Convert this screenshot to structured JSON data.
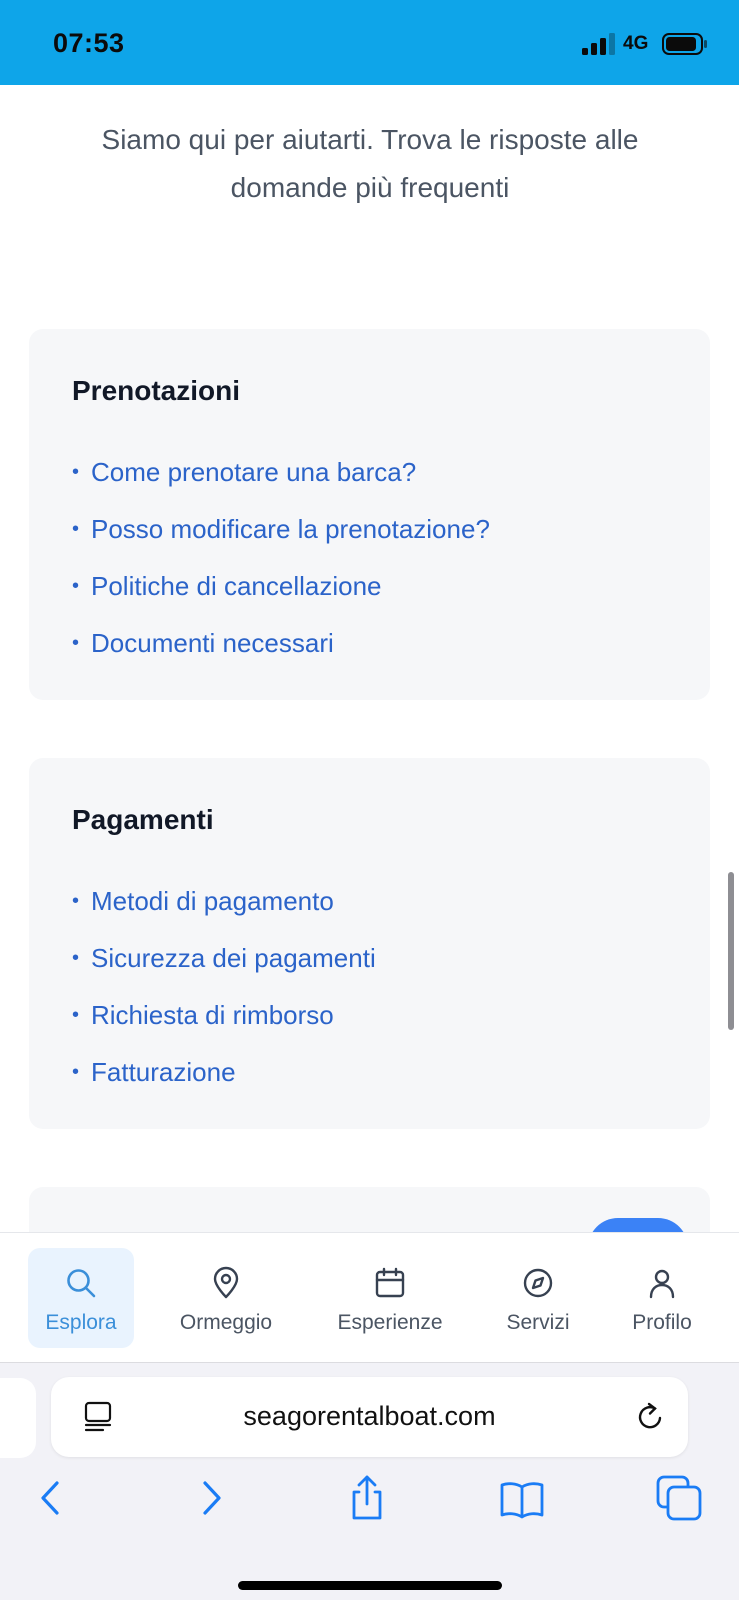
{
  "status_bar": {
    "time": "07:53",
    "network": "4G",
    "bg_color": "#0ea5e9",
    "icons": [
      "signal-bars-icon",
      "battery-icon"
    ]
  },
  "main": {
    "subtitle": "Siamo qui per aiutarti. Trova le risposte alle domande più frequenti",
    "sections": [
      {
        "title": "Prenotazioni",
        "items": [
          "Come prenotare una barca?",
          "Posso modificare la prenotazione?",
          "Politiche di cancellazione",
          "Documenti necessari"
        ]
      },
      {
        "title": "Pagamenti",
        "items": [
          "Metodi di pagamento",
          "Sicurezza dei pagamenti",
          "Richiesta di rimborso",
          "Fatturazione"
        ]
      }
    ],
    "bullet": "•",
    "link_color": "#2b63c9"
  },
  "bottom_nav": {
    "items": [
      {
        "label": "Esplora",
        "icon": "search-icon",
        "active": true
      },
      {
        "label": "Ormeggio",
        "icon": "map-pin-icon",
        "active": false
      },
      {
        "label": "Esperienze",
        "icon": "calendar-icon",
        "active": false
      },
      {
        "label": "Servizi",
        "icon": "compass-icon",
        "active": false
      },
      {
        "label": "Profilo",
        "icon": "user-icon",
        "active": false
      }
    ],
    "active_color": "#3b8fd9"
  },
  "browser": {
    "url": "seagorentalboat.com",
    "icons": [
      "reader-mode-icon",
      "reload-icon",
      "back-icon",
      "forward-icon",
      "share-icon",
      "bookmarks-icon",
      "tabs-icon"
    ],
    "accent_color": "#1a7cf5"
  }
}
